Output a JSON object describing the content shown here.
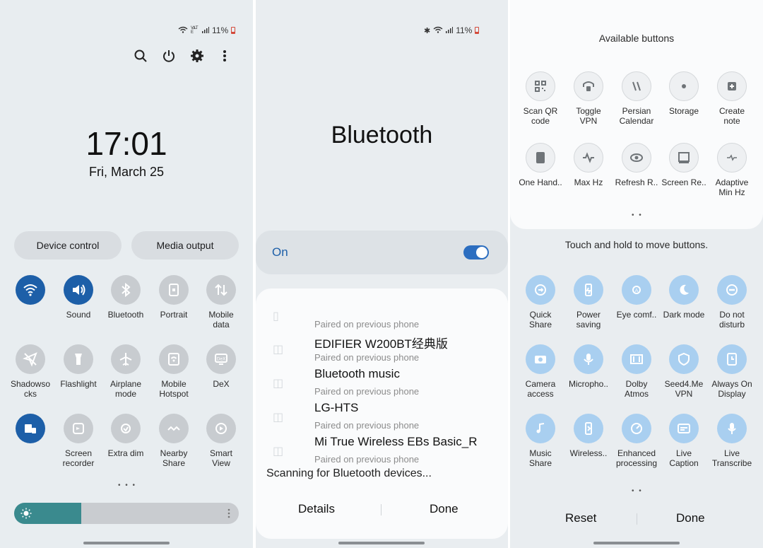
{
  "panel1": {
    "status": {
      "signal": "VoLTE",
      "battery": "11%"
    },
    "time": "17:01",
    "date": "Fri, March 25",
    "pills": {
      "device_control": "Device control",
      "media_output": "Media output"
    },
    "tiles": [
      {
        "label": "",
        "icon": "wifi-icon",
        "state": "on"
      },
      {
        "label": "Sound",
        "icon": "sound-icon",
        "state": "on"
      },
      {
        "label": "Bluetooth",
        "icon": "bluetooth-icon",
        "state": "off"
      },
      {
        "label": "Portrait",
        "icon": "portrait-lock-icon",
        "state": "off"
      },
      {
        "label": "Mobile\ndata",
        "icon": "mobile-data-icon",
        "state": "off"
      },
      {
        "label": "Shadowso\ncks",
        "icon": "paper-plane-icon",
        "state": "off"
      },
      {
        "label": "Flashlight",
        "icon": "flashlight-icon",
        "state": "off"
      },
      {
        "label": "Airplane\nmode",
        "icon": "airplane-icon",
        "state": "off"
      },
      {
        "label": "Mobile\nHotspot",
        "icon": "hotspot-icon",
        "state": "off"
      },
      {
        "label": "DeX",
        "icon": "dex-icon",
        "state": "off"
      },
      {
        "label": "",
        "icon": "devices-icon",
        "state": "on"
      },
      {
        "label": "Screen\nrecorder",
        "icon": "screen-recorder-icon",
        "state": "off"
      },
      {
        "label": "Extra dim",
        "icon": "extra-dim-icon",
        "state": "off"
      },
      {
        "label": "Nearby\nShare",
        "icon": "nearby-share-icon",
        "state": "off"
      },
      {
        "label": "Smart\nView",
        "icon": "smart-view-icon",
        "state": "off"
      }
    ],
    "page_dots": "• • •",
    "brightness": 0.3
  },
  "panel2": {
    "status": {
      "battery": "11%"
    },
    "title": "Bluetooth",
    "on_label": "On",
    "toggle_on": true,
    "devices": [
      {
        "sub": "Paired on previous phone",
        "name": "EDIFIER W200BT经典版"
      },
      {
        "sub": "Paired on previous phone",
        "name": "Bluetooth music"
      },
      {
        "sub": "Paired on previous phone",
        "name": "LG-HTS"
      },
      {
        "sub": "Paired on previous phone",
        "name": "Mi True Wireless EBs Basic_R"
      },
      {
        "sub": "Paired on previous phone",
        "name": ""
      }
    ],
    "scanning": "Scanning for Bluetooth devices...",
    "details": "Details",
    "done": "Done"
  },
  "panel3": {
    "available_title": "Available buttons",
    "available": [
      {
        "label": "Scan QR\ncode",
        "icon": "qr-code-icon"
      },
      {
        "label": "Toggle\nVPN",
        "icon": "vpn-icon"
      },
      {
        "label": "Persian\nCalendar",
        "icon": "persian-calendar-icon"
      },
      {
        "label": "Storage",
        "icon": "storage-icon"
      },
      {
        "label": "Create\nnote",
        "icon": "create-note-icon"
      },
      {
        "label": "One Hand..",
        "icon": "one-hand-icon"
      },
      {
        "label": "Max Hz",
        "icon": "max-hz-icon"
      },
      {
        "label": "Refresh R..",
        "icon": "refresh-rate-icon"
      },
      {
        "label": "Screen Re..",
        "icon": "screen-resolution-icon"
      },
      {
        "label": "Adaptive\nMin Hz",
        "icon": "adaptive-min-hz-icon"
      }
    ],
    "avail_dots": "• •",
    "hint": "Touch and hold to move buttons.",
    "active": [
      {
        "label": "Quick\nShare",
        "icon": "quick-share-icon"
      },
      {
        "label": "Power\nsaving",
        "icon": "power-saving-icon"
      },
      {
        "label": "Eye comf..",
        "icon": "eye-comfort-icon"
      },
      {
        "label": "Dark mode",
        "icon": "dark-mode-icon"
      },
      {
        "label": "Do not\ndisturb",
        "icon": "do-not-disturb-icon"
      },
      {
        "label": "Camera\naccess",
        "icon": "camera-access-icon"
      },
      {
        "label": "Micropho..",
        "icon": "microphone-icon"
      },
      {
        "label": "Dolby\nAtmos",
        "icon": "dolby-atmos-icon"
      },
      {
        "label": "Seed4.Me\nVPN",
        "icon": "shield-icon"
      },
      {
        "label": "Always On\nDisplay",
        "icon": "always-on-display-icon"
      },
      {
        "label": "Music\nShare",
        "icon": "music-share-icon"
      },
      {
        "label": "Wireless..",
        "icon": "wireless-powershare-icon"
      },
      {
        "label": "Enhanced\nprocessing",
        "icon": "enhanced-processing-icon"
      },
      {
        "label": "Live\nCaption",
        "icon": "live-caption-icon"
      },
      {
        "label": "Live\nTranscribe",
        "icon": "live-transcribe-icon"
      }
    ],
    "active_dots": "• •",
    "reset": "Reset",
    "done": "Done"
  }
}
